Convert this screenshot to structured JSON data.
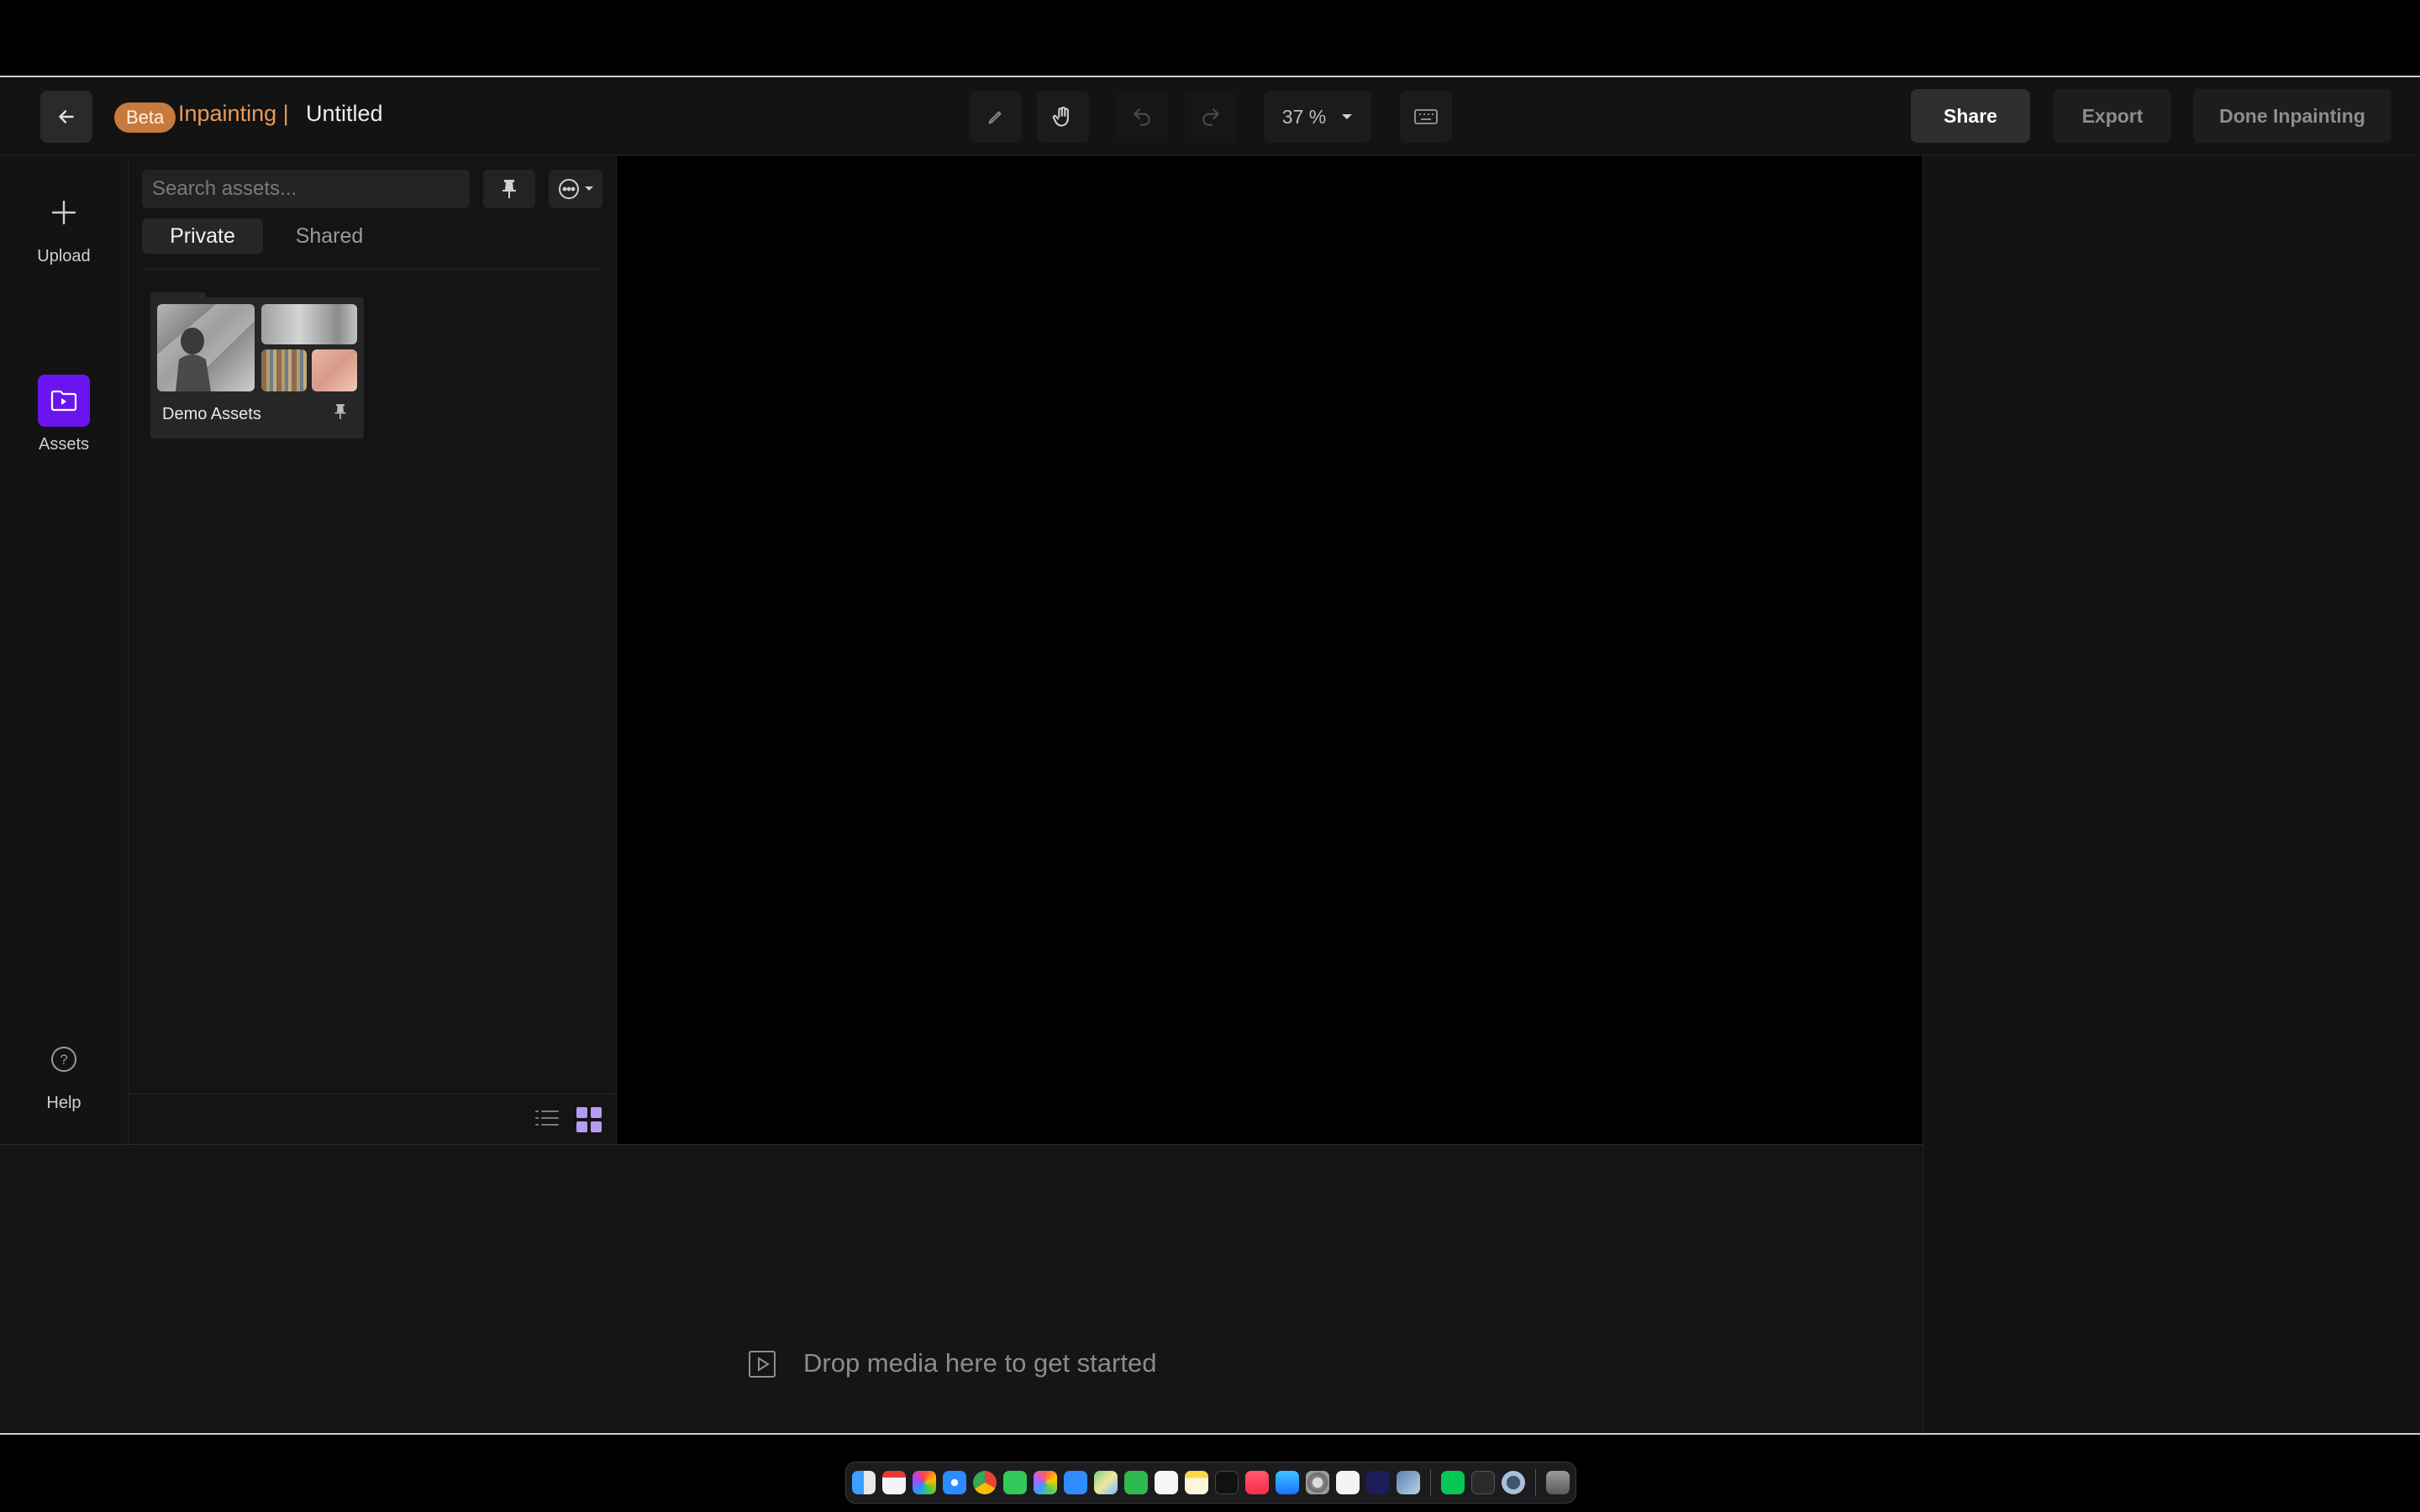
{
  "header": {
    "beta_label": "Beta",
    "app_title": "Inpainting |",
    "doc_title": "Untitled",
    "zoom_value": "37 %",
    "share_label": "Share",
    "export_label": "Export",
    "done_label": "Done Inpainting"
  },
  "rail": {
    "upload_label": "Upload",
    "assets_label": "Assets",
    "help_label": "Help"
  },
  "assets": {
    "search_placeholder": "Search assets...",
    "tabs": [
      {
        "label": "Private",
        "active": true
      },
      {
        "label": "Shared",
        "active": false
      }
    ],
    "folders": [
      {
        "name": "Demo Assets"
      }
    ]
  },
  "timeline": {
    "drop_text": "Drop media here to get started"
  },
  "colors": {
    "accent": "#6a14f0",
    "beta_badge": "#c77a3d",
    "app_title": "#e89a5b",
    "grid_icon": "#b59cf0"
  },
  "dock_icons": [
    "finder-icon",
    "calendar-icon",
    "launchpad-icon",
    "safari-icon",
    "chrome-icon",
    "messages-icon",
    "photos-icon",
    "mail-icon",
    "maps-icon",
    "facetime-icon",
    "reminders-icon",
    "notes-icon",
    "tv-icon",
    "music-icon",
    "app-store-icon",
    "settings-icon",
    "vectorworks-icon",
    "premiere-icon",
    "preview-icon",
    "line-icon",
    "terminal-icon",
    "quicktime-icon",
    "trash-icon"
  ]
}
